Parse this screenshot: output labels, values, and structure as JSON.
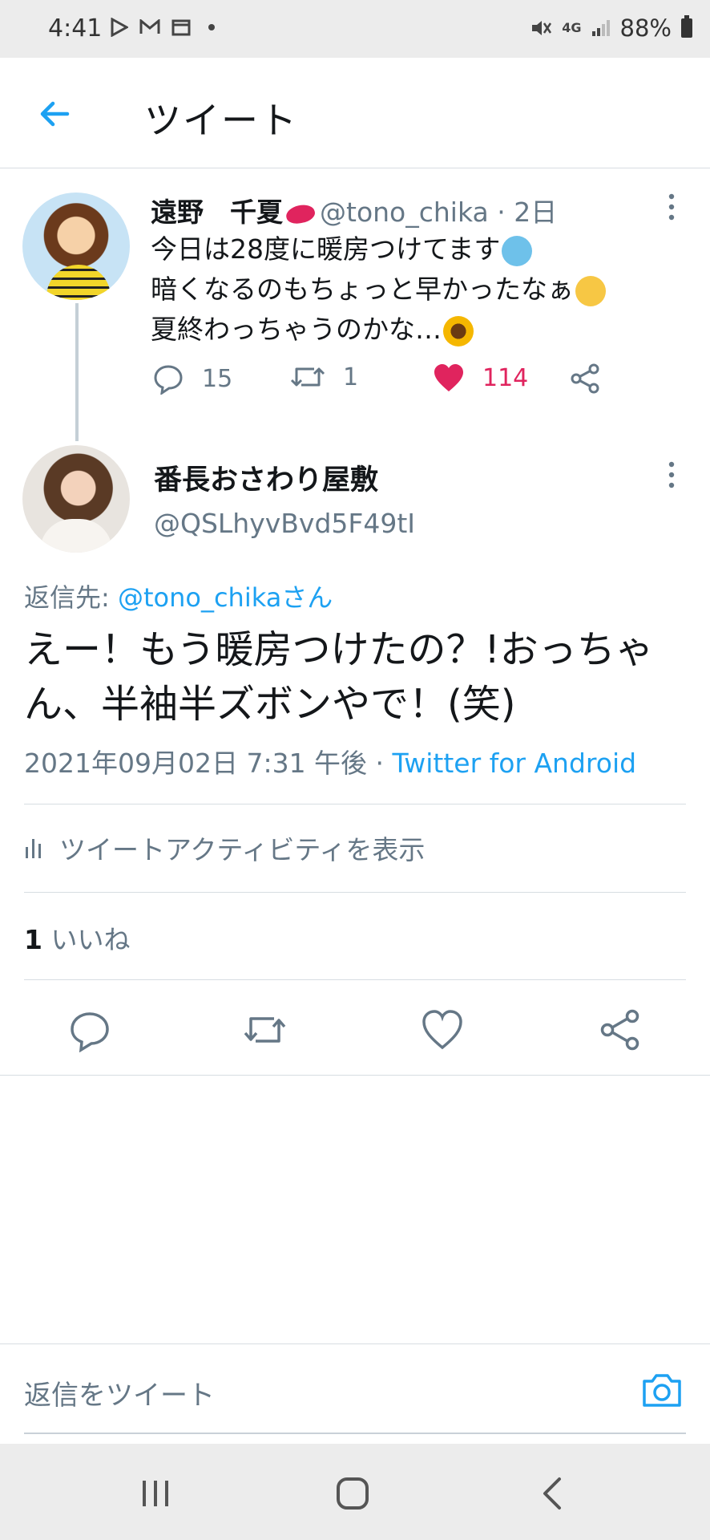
{
  "status_bar": {
    "time": "4:41",
    "battery": "88%",
    "network": "4G",
    "icons_left": [
      "play-store-icon",
      "gmail-icon",
      "calendar-icon",
      "dot-icon"
    ],
    "icons_right": [
      "mute-icon",
      "network-4g-icon",
      "signal-icon",
      "battery-icon"
    ]
  },
  "header": {
    "title": "ツイート",
    "back_icon": "back-arrow-icon"
  },
  "original_tweet": {
    "name": "遠野　千夏",
    "handle": "@tono_chika",
    "time": "· 2日",
    "lines": [
      "今日は28度に暖房つけてます",
      "暗くなるのもちょっと早かったなぁ",
      "夏終わっちゃうのかな…"
    ],
    "reply_count": "15",
    "retweet_count": "1",
    "like_count": "114",
    "accent_like": "#e0245e"
  },
  "reply_tweet": {
    "name": "番長おさわり屋敷",
    "handle": "@QSLhyvBvd5F49tI",
    "reply_to_label": "返信先: ",
    "reply_to_link": "@tono_chikaさん",
    "body": "えー！もう暖房つけたの？!おっちゃん、半袖半ズボンやで！(笑)",
    "timestamp": "2021年09月02日 7:31 午後 · ",
    "source": "Twitter for Android",
    "activity_label": "ツイートアクティビティを表示",
    "likes_count": "1",
    "likes_label": " いいね"
  },
  "composer": {
    "placeholder": "返信をツイート",
    "camera_icon": "camera-icon"
  },
  "nav_bar": {
    "buttons": [
      "recent-apps-icon",
      "home-icon",
      "back-icon"
    ]
  },
  "colors": {
    "accent": "#1da1f2",
    "secondary_text": "#657786",
    "divider": "#d7dde2"
  }
}
